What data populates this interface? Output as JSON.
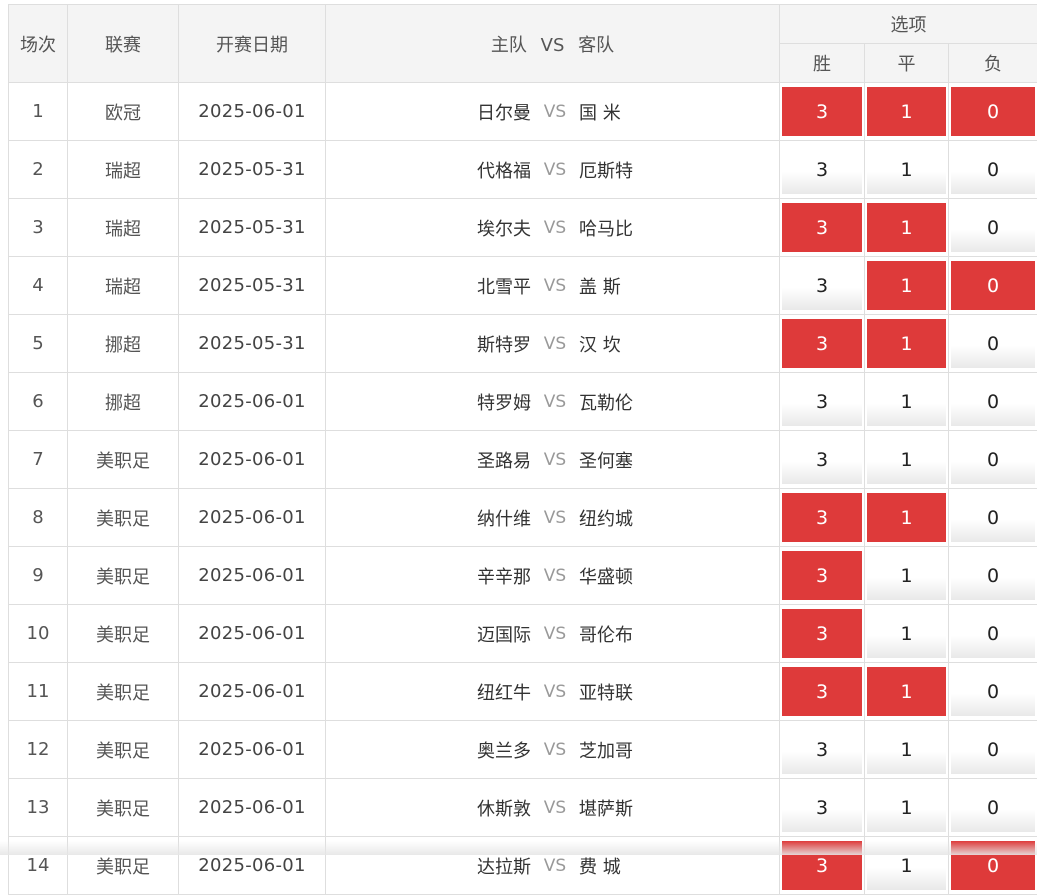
{
  "header": {
    "col_round": "场次",
    "col_league": "联赛",
    "col_date": "开赛日期",
    "col_home": "主队",
    "col_vs": "VS",
    "col_away": "客队",
    "col_options": "选项",
    "opt_win": "胜",
    "opt_draw": "平",
    "opt_lose": "负"
  },
  "vs_text": "VS",
  "rows": [
    {
      "no": "1",
      "league": "欧冠",
      "date": "2025-06-01",
      "home": "日尔曼",
      "away": "国 米",
      "win": "3",
      "draw": "1",
      "lose": "0",
      "sel": [
        true,
        true,
        true
      ]
    },
    {
      "no": "2",
      "league": "瑞超",
      "date": "2025-05-31",
      "home": "代格福",
      "away": "厄斯特",
      "win": "3",
      "draw": "1",
      "lose": "0",
      "sel": [
        false,
        false,
        false
      ]
    },
    {
      "no": "3",
      "league": "瑞超",
      "date": "2025-05-31",
      "home": "埃尔夫",
      "away": "哈马比",
      "win": "3",
      "draw": "1",
      "lose": "0",
      "sel": [
        true,
        true,
        false
      ]
    },
    {
      "no": "4",
      "league": "瑞超",
      "date": "2025-05-31",
      "home": "北雪平",
      "away": "盖 斯",
      "win": "3",
      "draw": "1",
      "lose": "0",
      "sel": [
        false,
        true,
        true
      ]
    },
    {
      "no": "5",
      "league": "挪超",
      "date": "2025-05-31",
      "home": "斯特罗",
      "away": "汉 坎",
      "win": "3",
      "draw": "1",
      "lose": "0",
      "sel": [
        true,
        true,
        false
      ]
    },
    {
      "no": "6",
      "league": "挪超",
      "date": "2025-06-01",
      "home": "特罗姆",
      "away": "瓦勒伦",
      "win": "3",
      "draw": "1",
      "lose": "0",
      "sel": [
        false,
        false,
        false
      ]
    },
    {
      "no": "7",
      "league": "美职足",
      "date": "2025-06-01",
      "home": "圣路易",
      "away": "圣何塞",
      "win": "3",
      "draw": "1",
      "lose": "0",
      "sel": [
        false,
        false,
        false
      ]
    },
    {
      "no": "8",
      "league": "美职足",
      "date": "2025-06-01",
      "home": "纳什维",
      "away": "纽约城",
      "win": "3",
      "draw": "1",
      "lose": "0",
      "sel": [
        true,
        true,
        false
      ]
    },
    {
      "no": "9",
      "league": "美职足",
      "date": "2025-06-01",
      "home": "辛辛那",
      "away": "华盛顿",
      "win": "3",
      "draw": "1",
      "lose": "0",
      "sel": [
        true,
        false,
        false
      ]
    },
    {
      "no": "10",
      "league": "美职足",
      "date": "2025-06-01",
      "home": "迈国际",
      "away": "哥伦布",
      "win": "3",
      "draw": "1",
      "lose": "0",
      "sel": [
        true,
        false,
        false
      ]
    },
    {
      "no": "11",
      "league": "美职足",
      "date": "2025-06-01",
      "home": "纽红牛",
      "away": "亚特联",
      "win": "3",
      "draw": "1",
      "lose": "0",
      "sel": [
        true,
        true,
        false
      ]
    },
    {
      "no": "12",
      "league": "美职足",
      "date": "2025-06-01",
      "home": "奥兰多",
      "away": "芝加哥",
      "win": "3",
      "draw": "1",
      "lose": "0",
      "sel": [
        false,
        false,
        false
      ]
    },
    {
      "no": "13",
      "league": "美职足",
      "date": "2025-06-01",
      "home": "休斯敦",
      "away": "堪萨斯",
      "win": "3",
      "draw": "1",
      "lose": "0",
      "sel": [
        false,
        false,
        false
      ]
    },
    {
      "no": "14",
      "league": "美职足",
      "date": "2025-06-01",
      "home": "达拉斯",
      "away": "费 城",
      "win": "3",
      "draw": "1",
      "lose": "0",
      "sel": [
        true,
        false,
        true
      ]
    }
  ],
  "colors": {
    "selected": "#de3a3a",
    "border": "#dedede",
    "header_bg": "#f4f4f4"
  }
}
